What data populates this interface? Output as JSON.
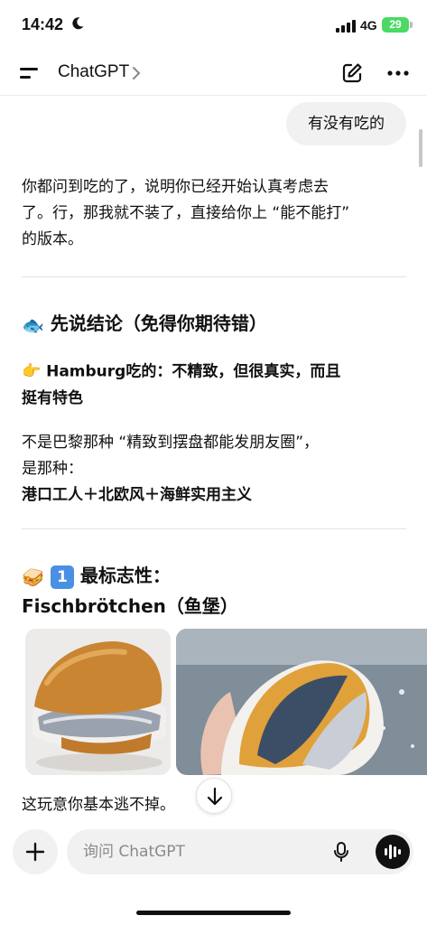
{
  "status_bar": {
    "time": "14:42",
    "network": "4G",
    "battery": "29",
    "battery_color": "#4cd964"
  },
  "header": {
    "title": "ChatGPT",
    "icons": [
      "menu-icon",
      "chevron-right-icon",
      "new-chat-icon",
      "more-icon"
    ]
  },
  "conversation": {
    "user_message": "有没有吃的",
    "intro": [
      "你都问到吃的了，说明你已经开始认真考虑去",
      "了。行，那我就不装了，直接给你上 “能不能打”",
      "的版本。"
    ],
    "section1": {
      "emoji": "🐟",
      "heading": "先说结论（免得你期待错）",
      "point_emoji": "👉",
      "point_line1": "Hamburg吃的：不精致，但很真实，而且",
      "point_line2": "挺有特色",
      "note_line1": "不是巴黎那种 “精致到摆盘都能发朋友圈”，",
      "note_line2": "是那种：",
      "summary": "港口工人＋北欧风＋海鲜实用主义"
    },
    "section2": {
      "emoji": "🥪",
      "number": "1",
      "heading_line1": "最标志性：",
      "heading_line2": "Fischbrötchen（鱼堡）",
      "caption": "这玩意你基本逃不掉。"
    }
  },
  "composer": {
    "placeholder": "询问 ChatGPT"
  }
}
